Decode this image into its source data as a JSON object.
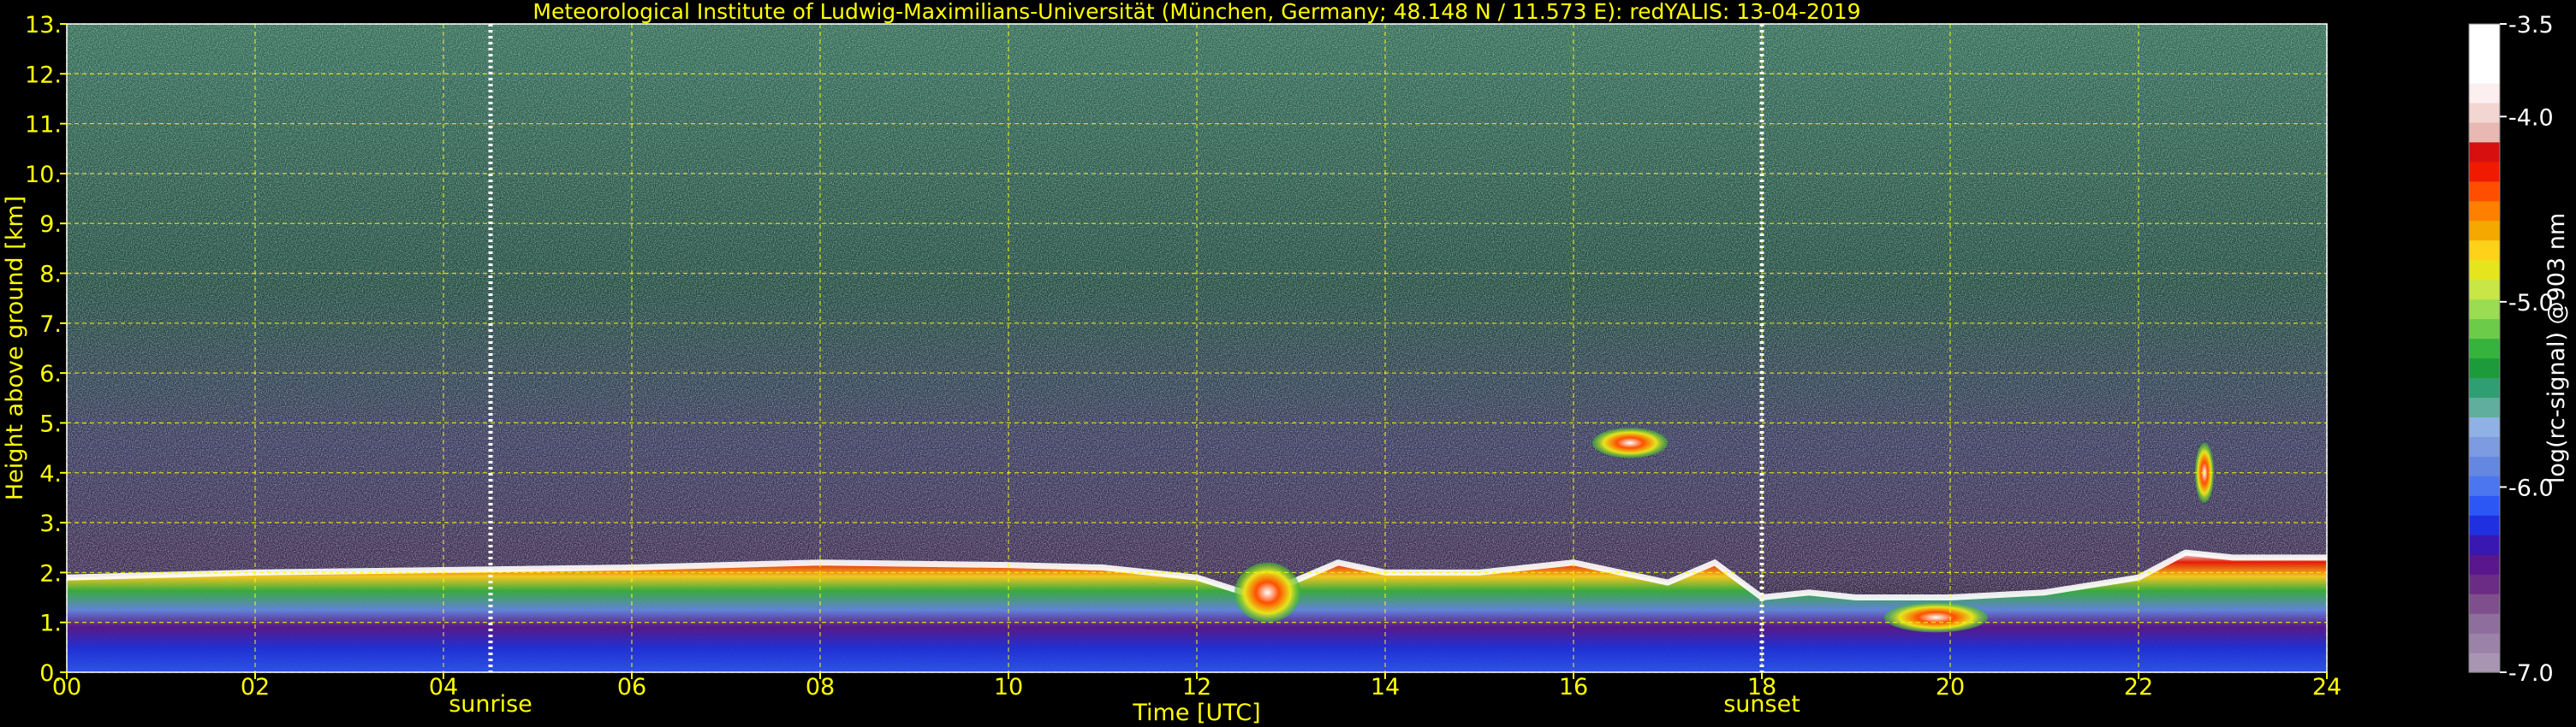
{
  "chart_data": {
    "type": "heatmap",
    "title": "Meteorological Institute of Ludwig-Maximilians-Universität (München, Germany; 48.148 N / 11.573 E):    redYALIS: 13-04-2019",
    "xlabel": "Time [UTC]",
    "ylabel": "Height above ground [km]",
    "xlim": [
      0,
      24
    ],
    "ylim": [
      0,
      13
    ],
    "x_ticks": [
      "00",
      "02",
      "04",
      "06",
      "08",
      "10",
      "12",
      "14",
      "16",
      "18",
      "20",
      "22",
      "24"
    ],
    "y_ticks": [
      "0.",
      "1.",
      "2.",
      "3.",
      "4.",
      "5.",
      "6.",
      "7.",
      "8.",
      "9.",
      "10.",
      "11.",
      "12.",
      "13."
    ],
    "grid": true,
    "colorbar": {
      "label": "log(rc-signal) @903 nm",
      "range": [
        -7.0,
        -3.5
      ],
      "ticks": [
        "-3.5",
        "-4.0",
        "-5.0",
        "-6.0",
        "-7.0"
      ],
      "colors": [
        "#a895b4",
        "#9b82a8",
        "#8e6e9c",
        "#7e4f8c",
        "#6a2c84",
        "#5a168c",
        "#3818b0",
        "#1f30e0",
        "#2d57f5",
        "#4b76ef",
        "#6488e2",
        "#7c9be0",
        "#8fb1e6",
        "#5fae9e",
        "#2f9e72",
        "#1d9a3a",
        "#36b33c",
        "#6ccc4a",
        "#9adc52",
        "#c8e646",
        "#e6e51d",
        "#ffd21a",
        "#f4a800",
        "#ff8000",
        "#ff4e00",
        "#f01a00",
        "#d80f0f",
        "#e8b8b2",
        "#f3d6d2",
        "#fbf0ef",
        "#ffffff",
        "#ffffff",
        "#ffffff"
      ]
    },
    "markers": [
      {
        "label": "sunrise",
        "time": 4.5
      },
      {
        "label": "sunset",
        "time": 18.0
      }
    ],
    "boundary_layer_top_km": {
      "time": [
        0,
        2,
        4,
        6,
        8,
        10,
        11,
        12,
        12.5,
        13,
        13.5,
        14,
        15,
        16,
        17,
        17.5,
        18,
        18.5,
        19,
        20,
        21,
        22,
        22.5,
        23,
        24
      ],
      "height": [
        1.9,
        2.0,
        2.05,
        2.1,
        2.2,
        2.15,
        2.1,
        1.9,
        1.6,
        1.8,
        2.2,
        2.0,
        2.0,
        2.2,
        1.8,
        2.2,
        1.5,
        1.6,
        1.5,
        1.5,
        1.6,
        1.9,
        2.4,
        2.3,
        2.3
      ]
    },
    "cloud_features": [
      {
        "time_start": 16.2,
        "time_end": 17.0,
        "height_start": 4.3,
        "height_end": 4.9
      },
      {
        "time_start": 22.6,
        "time_end": 22.8,
        "height_start": 3.4,
        "height_end": 4.6
      },
      {
        "time_start": 12.4,
        "time_end": 13.1,
        "height_start": 1.0,
        "height_end": 2.2
      },
      {
        "time_start": 19.3,
        "time_end": 20.4,
        "height_start": 0.8,
        "height_end": 1.4
      }
    ]
  }
}
